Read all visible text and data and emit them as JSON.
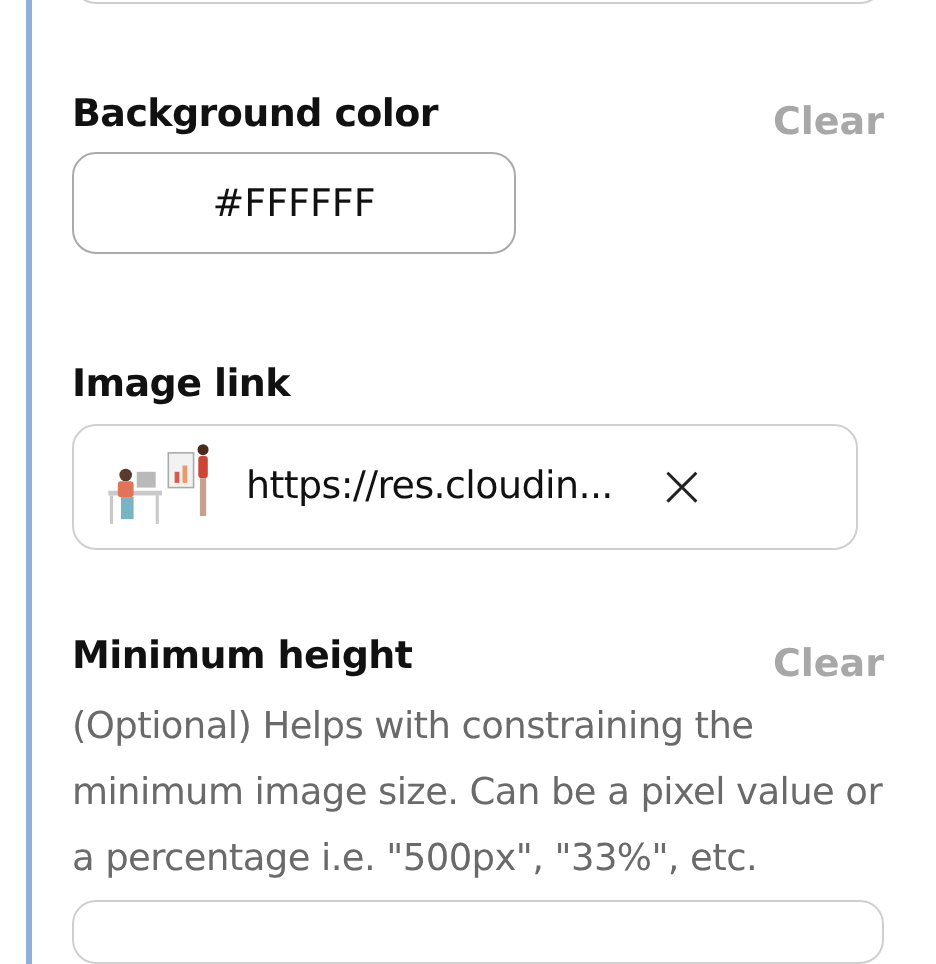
{
  "background_color": {
    "label": "Background color",
    "clear": "Clear",
    "value": "#FFFFFF"
  },
  "image_link": {
    "label": "Image link",
    "value": "https://res.cloudin...",
    "clear_icon": "×"
  },
  "minimum_height": {
    "label": "Minimum height",
    "clear": "Clear",
    "description": "(Optional) Helps with constraining the minimum image size. Can be a pixel value or a percentage i.e. \"500px\", \"33%\", etc."
  }
}
